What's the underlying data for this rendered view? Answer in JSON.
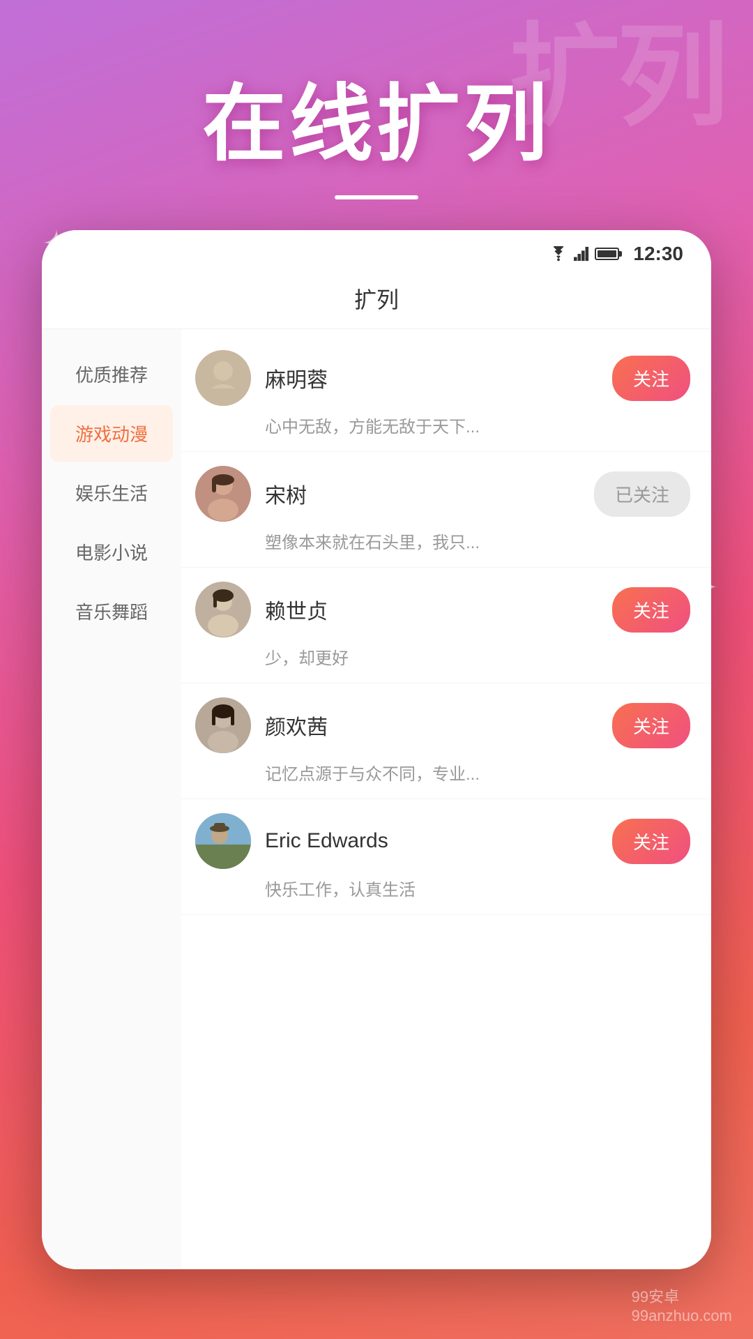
{
  "background": {
    "bgText": "扩列"
  },
  "header": {
    "mainTitle": "在线扩列",
    "watermark": "99安卓\n99anzhuo.com"
  },
  "statusBar": {
    "time": "12:30"
  },
  "appBar": {
    "title": "扩列"
  },
  "sidebar": {
    "items": [
      {
        "label": "优质推荐",
        "active": false
      },
      {
        "label": "游戏动漫",
        "active": true
      },
      {
        "label": "娱乐生活",
        "active": false
      },
      {
        "label": "电影小说",
        "active": false
      },
      {
        "label": "音乐舞蹈",
        "active": false
      }
    ]
  },
  "users": [
    {
      "name": "麻明蓉",
      "bio": "心中无敌，方能无敌于天下...",
      "followed": false,
      "followLabel": "关注",
      "followingLabel": "已关注"
    },
    {
      "name": "宋树",
      "bio": "塑像本来就在石头里，我只...",
      "followed": true,
      "followLabel": "关注",
      "followingLabel": "已关注"
    },
    {
      "name": "赖世贞",
      "bio": "少，却更好",
      "followed": false,
      "followLabel": "关注",
      "followingLabel": "已关注"
    },
    {
      "name": "颜欢茜",
      "bio": "记忆点源于与众不同，专业...",
      "followed": false,
      "followLabel": "关注",
      "followingLabel": "已关注"
    },
    {
      "name": "Eric Edwards",
      "bio": "快乐工作，认真生活",
      "followed": false,
      "followLabel": "关注",
      "followingLabel": "已关注"
    }
  ]
}
